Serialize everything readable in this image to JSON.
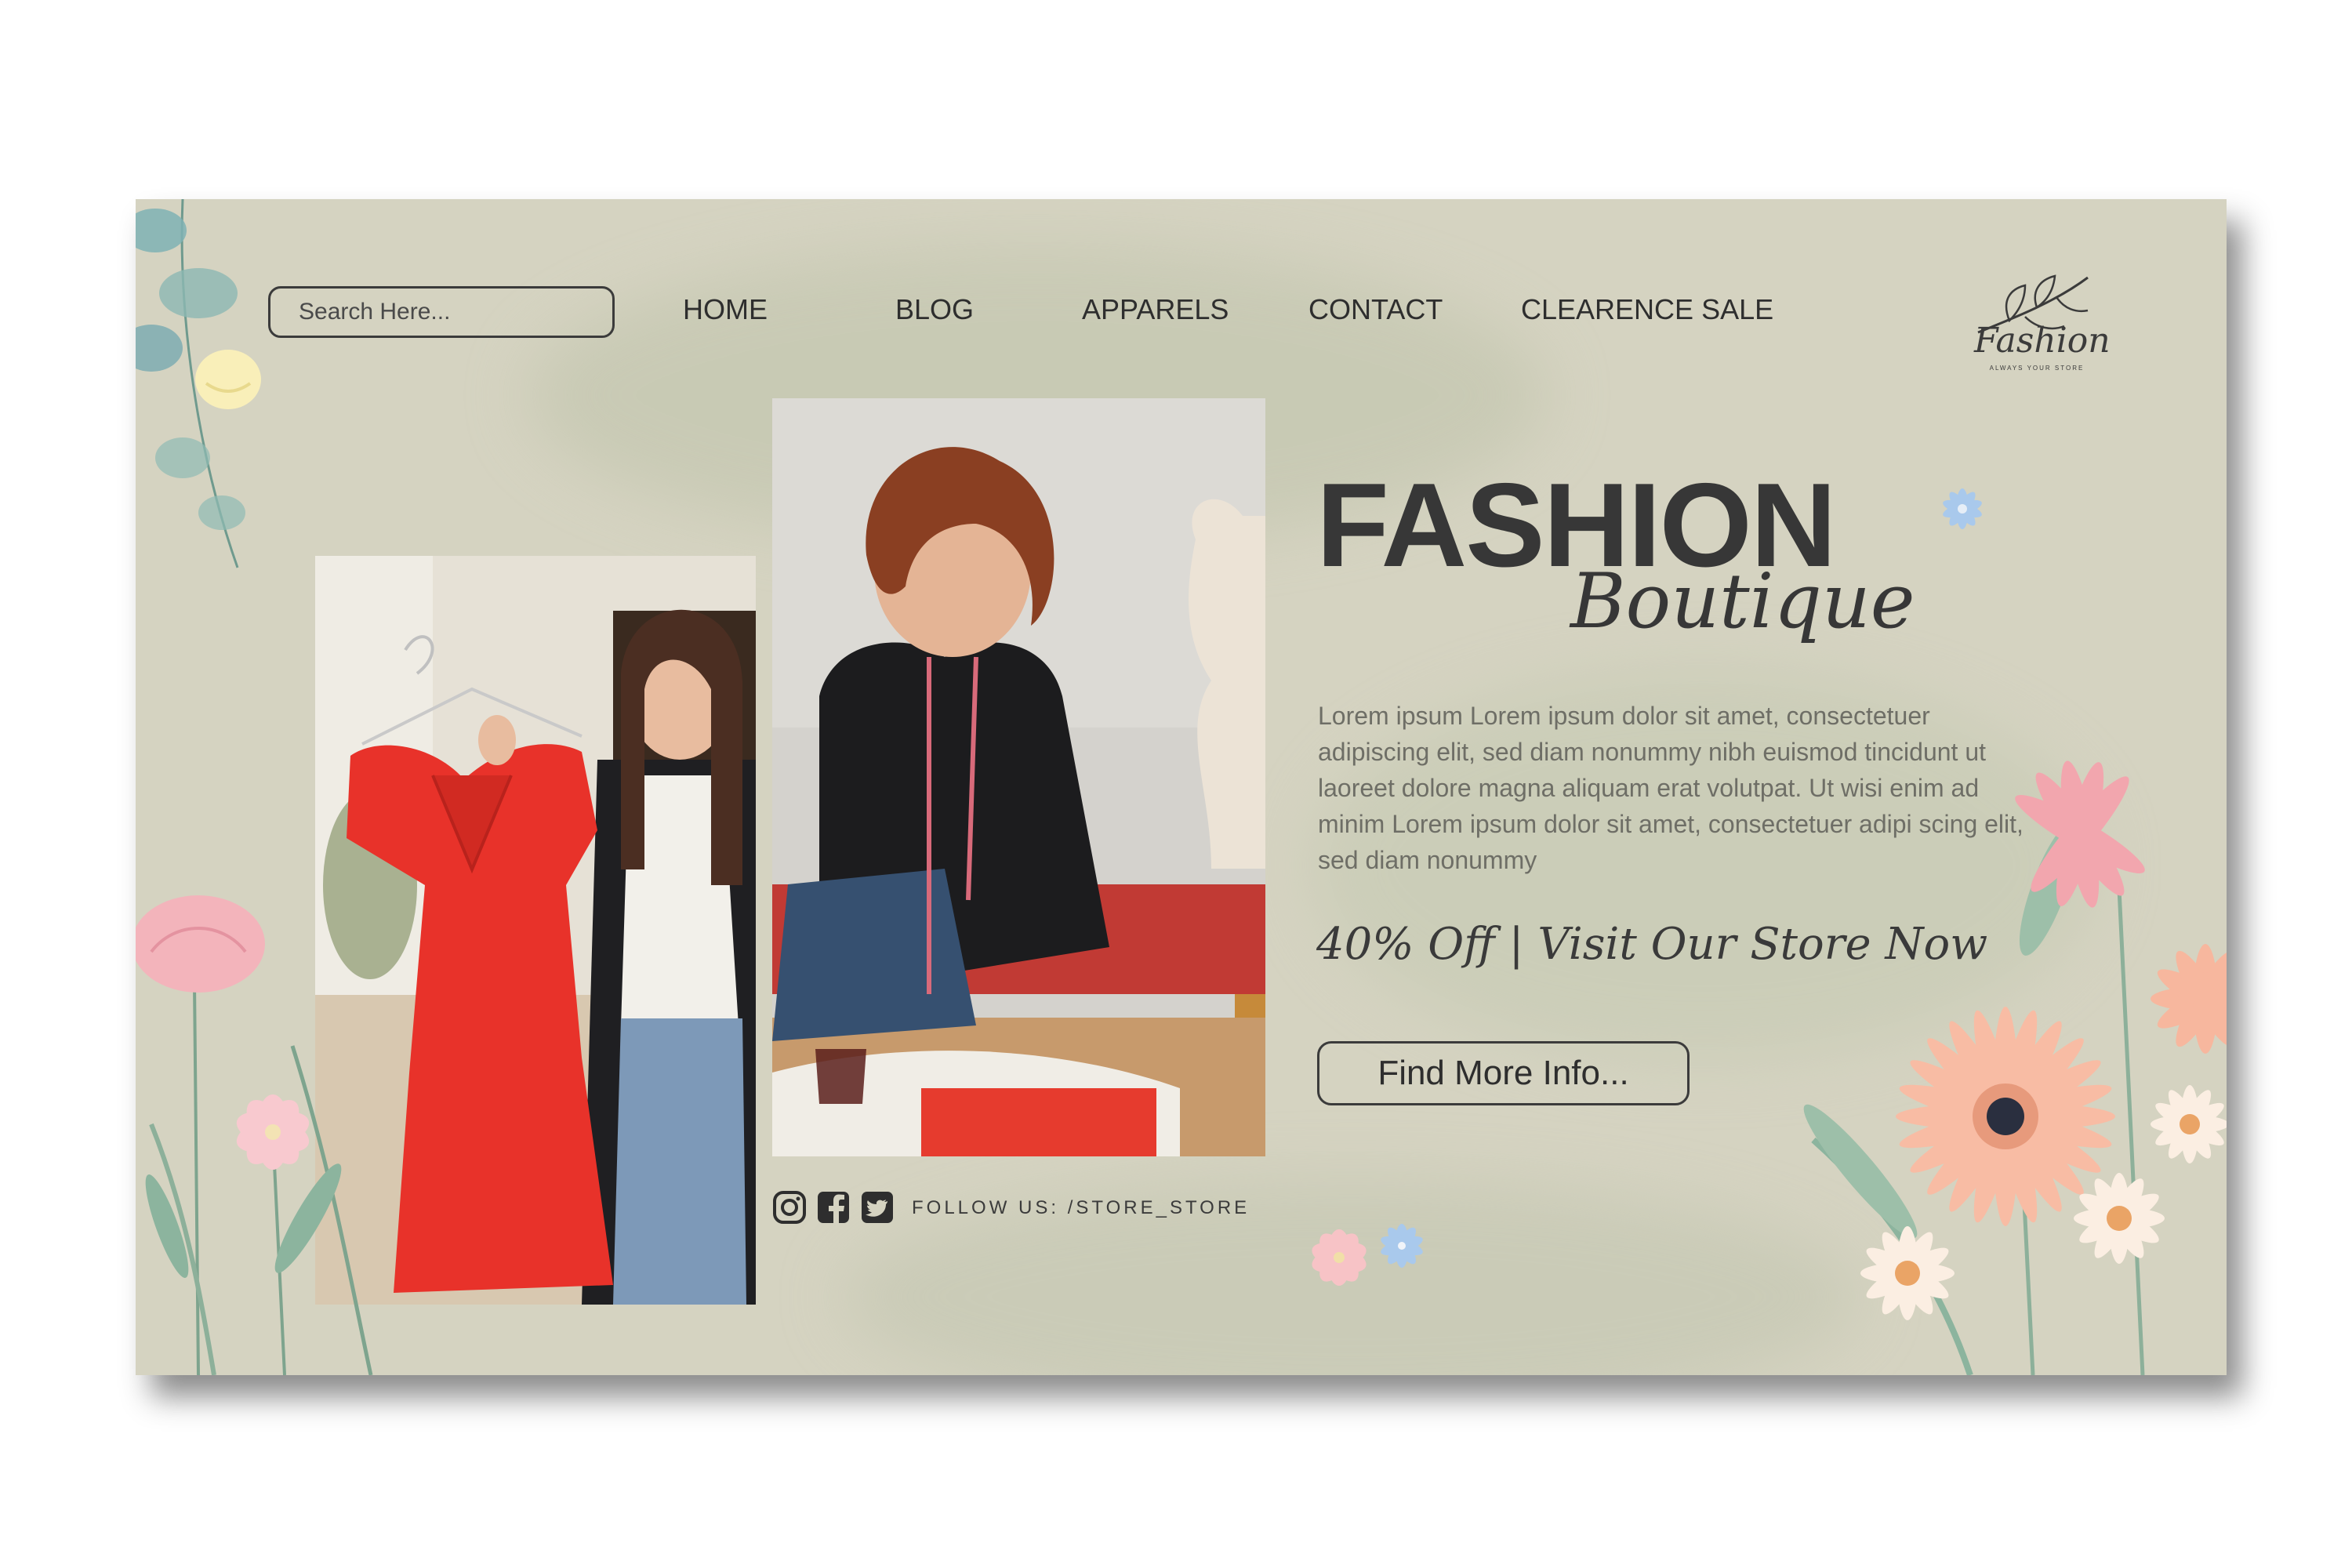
{
  "search": {
    "placeholder": "Search Here..."
  },
  "nav": {
    "items": [
      {
        "label": "HOME"
      },
      {
        "label": "BLOG"
      },
      {
        "label": "APPARELS"
      },
      {
        "label": "CONTACT"
      },
      {
        "label": "CLEARENCE SALE"
      }
    ]
  },
  "logo": {
    "name": "Fashion",
    "tagline": "ALWAYS YOUR STORE"
  },
  "hero": {
    "title": "FASHION",
    "subtitle": "Boutique",
    "description": "Lorem ipsum Lorem ipsum dolor sit amet, consectetuer adipiscing elit, sed diam nonummy nibh euismod tincidunt ut laoreet dolore magna aliquam erat volutpat. Ut wisi enim ad minim Lorem ipsum dolor sit amet, consectetuer adipi scing elit, sed diam nonummy",
    "promo": "40% Off | Visit Our Store Now",
    "cta_label": "Find More Info..."
  },
  "social": {
    "icons": [
      "instagram-icon",
      "facebook-icon",
      "twitter-icon"
    ],
    "follow_text": "FOLLOW US: /STORE_STORE"
  },
  "colors": {
    "background": "#d5d3c1",
    "text": "#373737",
    "accent_red": "#e63b2e",
    "flower_peach": "#f6b49a",
    "flower_pink": "#eea3ac"
  }
}
